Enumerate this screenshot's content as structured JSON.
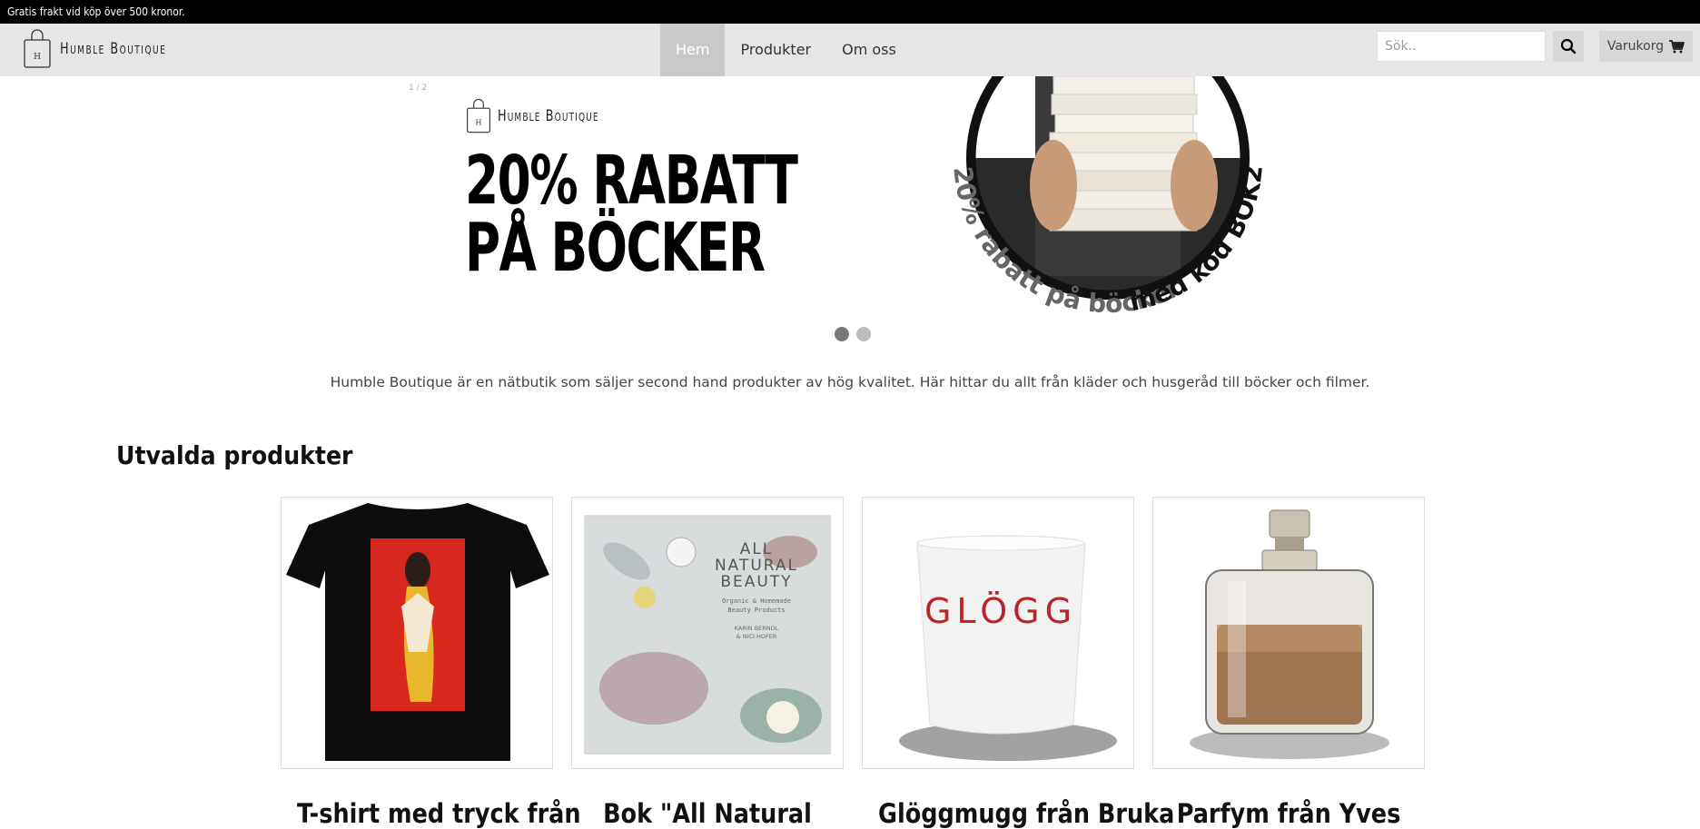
{
  "topbar": {
    "text": "Gratis frakt vid köp över 500 kronor."
  },
  "header": {
    "logo_text": "Humble Boutique",
    "nav": [
      {
        "label": "Hem",
        "active": true
      },
      {
        "label": "Produkter",
        "active": false
      },
      {
        "label": "Om oss",
        "active": false
      }
    ],
    "search": {
      "placeholder": "Sök..",
      "value": ""
    },
    "cart_label": "Varukorg"
  },
  "hero": {
    "small_text": "1 / 2",
    "logo_text": "Humble Boutique",
    "headline_line1": "20% RABATT",
    "headline_line2": "PÅ BÖCKER",
    "circle_text_1": "20% rabatt på böcker",
    "circle_text_2": "med kod BOK22",
    "slides_total": 2,
    "active_slide": 1
  },
  "intro_text": "Humble Boutique är en nätbutik som säljer second hand produkter av hög kvalitet. Här hittar du allt från kläder och husgeråd till böcker och filmer.",
  "featured": {
    "title": "Utvalda produkter",
    "products": [
      {
        "title": "T-shirt med tryck från",
        "image_icon": "tshirt-image"
      },
      {
        "title": "Bok \"All Natural",
        "image_icon": "book-image",
        "book_title": "ALL NATURAL BEAUTY",
        "book_subtitle": "Organic & Homemade Beauty Products",
        "book_authors": "KARIN BERNDL & NICI HOFER"
      },
      {
        "title": "Glöggmugg från Bruka",
        "image_icon": "mug-image",
        "mug_text": "GLÖGG"
      },
      {
        "title": "Parfym från Yves",
        "image_icon": "perfume-image"
      }
    ]
  },
  "colors": {
    "topbar": "#000000",
    "navbar": "#e6e6e6",
    "active_nav": "#c9c9c9"
  }
}
